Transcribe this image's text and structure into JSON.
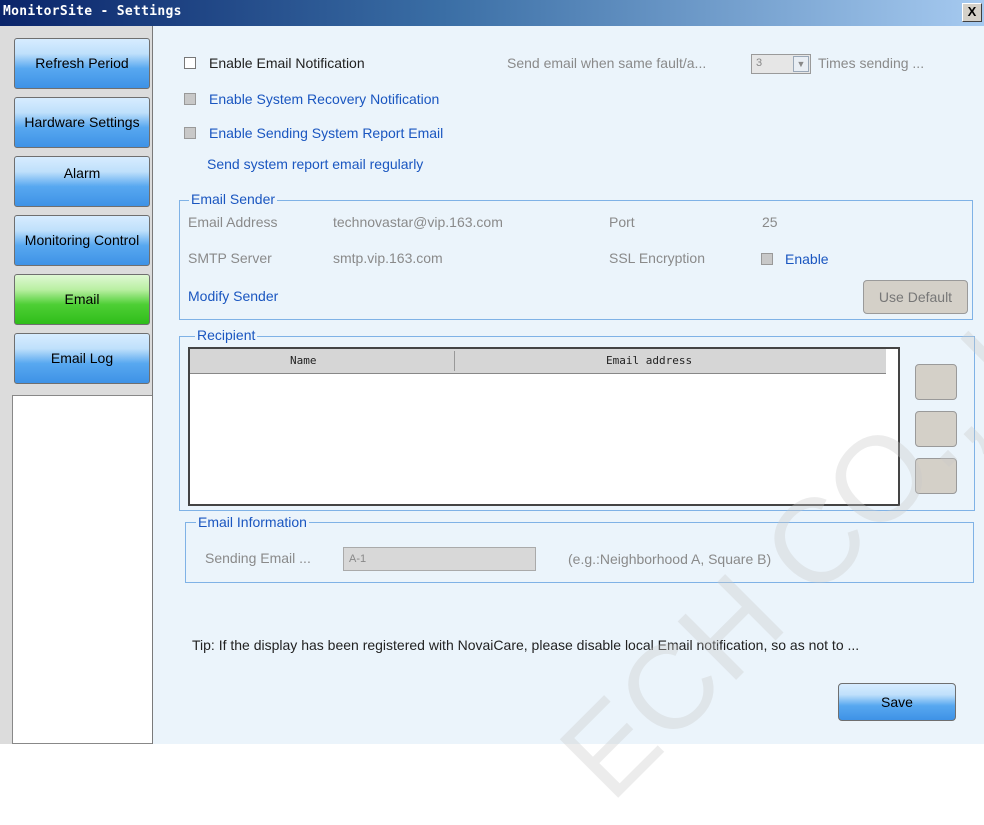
{
  "window": {
    "title": "MonitorSite - Settings",
    "close_label": "X"
  },
  "sidebar": {
    "items": [
      {
        "label": "Refresh Period",
        "active": false
      },
      {
        "label": "Hardware Settings",
        "active": false
      },
      {
        "label": "Alarm",
        "active": false
      },
      {
        "label": "Monitoring Control",
        "active": false
      },
      {
        "label": "Email",
        "active": true
      },
      {
        "label": "Email Log",
        "active": false
      }
    ]
  },
  "email": {
    "enable_email_notification": "Enable Email Notification",
    "send_when_same_fault": "Send email when same fault/a...",
    "times_value": "3",
    "times_sending": "Times sending ...",
    "enable_recovery": "Enable System Recovery Notification",
    "enable_report": "Enable Sending System Report Email",
    "report_regularly": "Send system report email regularly"
  },
  "sender": {
    "legend": "Email Sender",
    "email_address_label": "Email Address",
    "email_address_value": "technovastar@vip.163.com",
    "port_label": "Port",
    "port_value": "25",
    "smtp_label": "SMTP Server",
    "smtp_value": "smtp.vip.163.com",
    "ssl_label": "SSL Encryption",
    "ssl_enable_label": "Enable",
    "modify_sender": "Modify Sender",
    "use_default": "Use Default"
  },
  "recipient": {
    "legend": "Recipient",
    "columns": [
      "Name",
      "Email address"
    ]
  },
  "info": {
    "legend": "Email Information",
    "sending_label": "Sending Email ...",
    "sending_value": "A-1",
    "example": "(e.g.:Neighborhood A, Square B)"
  },
  "tip": "Tip: If the display has been registered with NovaiCare, please disable local Email notification, so as not to ...",
  "save_label": "Save",
  "watermark": "ECH CO., LT"
}
